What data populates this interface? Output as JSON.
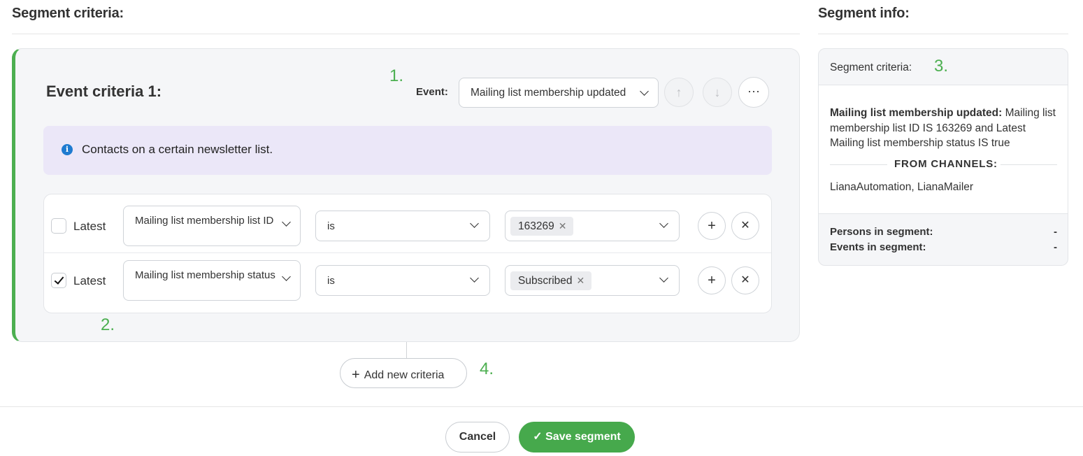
{
  "left_title": "Segment criteria:",
  "right_title": "Segment info:",
  "criteria": {
    "title": "Event criteria 1:",
    "event_label": "Event:",
    "event_value": "Mailing list membership updated",
    "info_text": "Contacts on a certain newsletter list.",
    "rows": [
      {
        "checked": false,
        "latest_label": "Latest",
        "field": "Mailing list membership list ID",
        "operator": "is",
        "value_tag": "163269"
      },
      {
        "checked": true,
        "latest_label": "Latest",
        "field": "Mailing list membership status",
        "operator": "is",
        "value_tag": "Subscribed"
      }
    ]
  },
  "annotations": [
    "1.",
    "2.",
    "3.",
    "4."
  ],
  "add_criteria_label": "Add new criteria",
  "cancel_label": "Cancel",
  "save_label": "Save segment",
  "info_panel": {
    "header_label": "Segment criteria:",
    "summary_bold": "Mailing list membership updated:",
    "summary_text": " Mailing list membership list ID IS 163269 and Latest Mailing list membership status IS true",
    "channels_label": "FROM CHANNELS:",
    "channels_value": "LianaAutomation, LianaMailer",
    "persons_label": "Persons in segment:",
    "persons_value": "-",
    "events_label": "Events in segment:",
    "events_value": "-"
  },
  "colors": {
    "accent": "#4caf50",
    "save_button": "#46a94c",
    "info_box": "#ebe7f8",
    "info_icon": "#1e7bd0"
  }
}
